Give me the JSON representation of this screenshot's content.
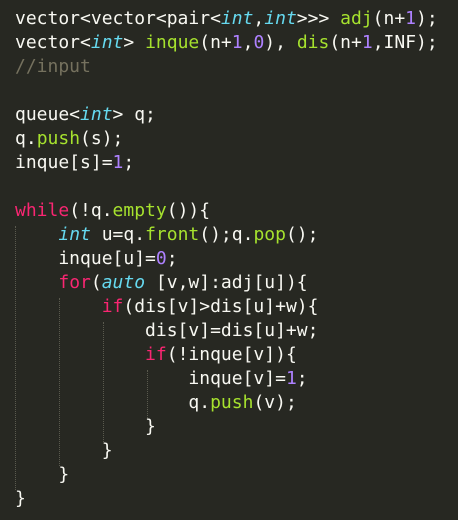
{
  "code_lines": [
    [
      [
        "pl",
        "vector<vector<pair<"
      ],
      [
        "ty",
        "int"
      ],
      [
        "pl",
        ","
      ],
      [
        "ty",
        "int"
      ],
      [
        "pl",
        ">>> "
      ],
      [
        "fn",
        "adj"
      ],
      [
        "pl",
        "(n+"
      ],
      [
        "num",
        "1"
      ],
      [
        "pl",
        ");"
      ]
    ],
    [
      [
        "pl",
        "vector<"
      ],
      [
        "ty",
        "int"
      ],
      [
        "pl",
        "> "
      ],
      [
        "fn",
        "inque"
      ],
      [
        "pl",
        "(n+"
      ],
      [
        "num",
        "1"
      ],
      [
        "pl",
        ","
      ],
      [
        "num",
        "0"
      ],
      [
        "pl",
        "), "
      ],
      [
        "fn",
        "dis"
      ],
      [
        "pl",
        "(n+"
      ],
      [
        "num",
        "1"
      ],
      [
        "pl",
        ",INF);"
      ]
    ],
    [
      [
        "cm",
        "//input"
      ]
    ],
    [],
    [
      [
        "pl",
        "queue<"
      ],
      [
        "ty",
        "int"
      ],
      [
        "pl",
        "> q;"
      ]
    ],
    [
      [
        "pl",
        "q."
      ],
      [
        "fn",
        "push"
      ],
      [
        "pl",
        "(s);"
      ]
    ],
    [
      [
        "pl",
        "inque[s]="
      ],
      [
        "num",
        "1"
      ],
      [
        "pl",
        ";"
      ]
    ],
    [],
    [
      [
        "kw",
        "while"
      ],
      [
        "pl",
        "(!q."
      ],
      [
        "fn",
        "empty"
      ],
      [
        "pl",
        "()){"
      ]
    ],
    [
      [
        "pl",
        "    "
      ],
      [
        "ty",
        "int"
      ],
      [
        "pl",
        " u=q."
      ],
      [
        "fn",
        "front"
      ],
      [
        "pl",
        "();q."
      ],
      [
        "fn",
        "pop"
      ],
      [
        "pl",
        "();"
      ]
    ],
    [
      [
        "pl",
        "    inque[u]="
      ],
      [
        "num",
        "0"
      ],
      [
        "pl",
        ";"
      ]
    ],
    [
      [
        "pl",
        "    "
      ],
      [
        "kw",
        "for"
      ],
      [
        "pl",
        "("
      ],
      [
        "ty",
        "auto"
      ],
      [
        "pl",
        " [v,w]:adj[u]){"
      ]
    ],
    [
      [
        "pl",
        "        "
      ],
      [
        "kw",
        "if"
      ],
      [
        "pl",
        "(dis[v]>dis[u]+w){"
      ]
    ],
    [
      [
        "pl",
        "            dis[v]=dis[u]+w;"
      ]
    ],
    [
      [
        "pl",
        "            "
      ],
      [
        "kw",
        "if"
      ],
      [
        "pl",
        "(!inque[v]){"
      ]
    ],
    [
      [
        "pl",
        "                inque[v]="
      ],
      [
        "num",
        "1"
      ],
      [
        "pl",
        ";"
      ]
    ],
    [
      [
        "pl",
        "                q."
      ],
      [
        "fn",
        "push"
      ],
      [
        "pl",
        "(v);"
      ]
    ],
    [
      [
        "pl",
        "            }"
      ]
    ],
    [
      [
        "pl",
        "        }"
      ]
    ],
    [
      [
        "pl",
        "    }"
      ]
    ],
    [
      [
        "pl",
        "}"
      ]
    ]
  ],
  "colors": {
    "background": "#272822",
    "plain": "#f8f8f2",
    "keyword": "#f92672",
    "type": "#66d9ef",
    "function": "#a6e22e",
    "number": "#ae81ff",
    "comment": "#75715e",
    "indent_guide": "#5a5a4e"
  }
}
